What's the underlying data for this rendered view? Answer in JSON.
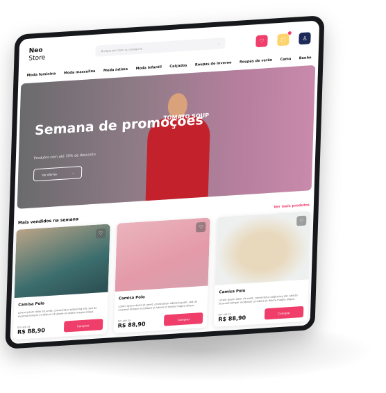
{
  "header": {
    "logo_top": "Neo",
    "logo_bottom": "Store",
    "search_placeholder": "Busque por item ou categoria",
    "cart_badge": "0"
  },
  "colors": {
    "accent": "#ef3e6a",
    "cart": "#fdd36a",
    "user": "#1d2a57"
  },
  "nav": [
    "Moda feminina",
    "Moda masculina",
    "Moda íntima",
    "Moda infantil",
    "Calçados",
    "Roupas de inverno",
    "Roupas de verão",
    "Cama",
    "Banho"
  ],
  "hero": {
    "title": "Semana de promoções",
    "subtitle": "Produtos com até 70% de desconto",
    "button": "Ver ofertas",
    "shirt_text": "TOMATO SOUP"
  },
  "section": {
    "title": "Mais vendidos na semana",
    "link": "Ver mais produtos"
  },
  "products": [
    {
      "name": "Camisa Polo",
      "description": "Lorem ipsum dolor sit amet, consectetur adipiscing elit, sed do eiusmod tempor incididunt ut labore et dolore magna aliqua.",
      "installments": "Em até 2x",
      "price": "R$ 88,90",
      "button": "Comprar"
    },
    {
      "name": "Camisa Polo",
      "description": "Lorem ipsum dolor sit amet, consectetur adipiscing elit, sed do eiusmod tempor incididunt ut labore et dolore magna aliqua.",
      "installments": "Em até 2x",
      "price": "R$ 88,90",
      "button": "Comprar"
    },
    {
      "name": "Camisa Polo",
      "description": "Lorem ipsum dolor sit amet, consectetur adipiscing elit, sed do eiusmod tempor incididunt ut labore et dolore magna aliqua.",
      "installments": "Em até 2x",
      "price": "R$ 88,90",
      "button": "Comprar"
    }
  ]
}
